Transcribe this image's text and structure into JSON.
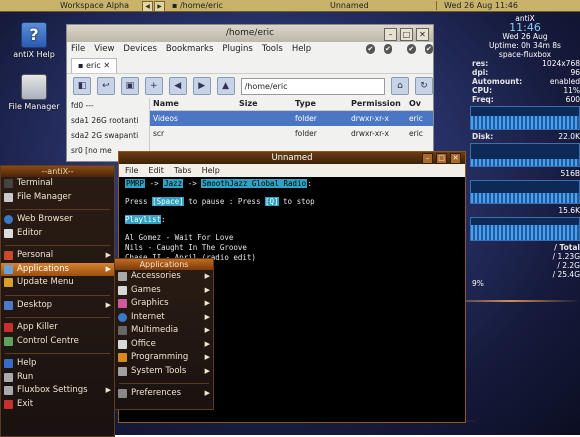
{
  "topbar": {
    "workspace": "Workspace Alpha",
    "tasks": [
      "/home/eric",
      "Unnamed"
    ],
    "datetime": "Wed 26 Aug",
    "time": "11:46"
  },
  "desktop_icons": [
    {
      "label": "antiX Help",
      "icon": "help-icon"
    },
    {
      "label": "File Manager",
      "icon": "file-manager-icon"
    }
  ],
  "conky": {
    "host": "antiX",
    "time": "11:46",
    "date": "Wed 26 Aug",
    "uptime": "Uptime: 0h 34m 8s",
    "wm": "space-fluxbox",
    "stats": [
      {
        "k": "res:",
        "v": "1024x768"
      },
      {
        "k": "dpi:",
        "v": "96"
      },
      {
        "k": "Automount:",
        "v": "enabled"
      },
      {
        "k": "CPU:",
        "v": "11%"
      },
      {
        "k": "Freq:",
        "v": "600"
      }
    ],
    "disk_label": "Disk:",
    "disk_value": "22.0K",
    "net1": "516B",
    "net2": "15.6K",
    "total_label": "/ Total",
    "totals": [
      "/ 1.23G",
      "/ 2.2G",
      "/ 25.4G"
    ],
    "percent": "9%"
  },
  "file_manager": {
    "title": "/home/eric",
    "menu": [
      "File",
      "View",
      "Devices",
      "Bookmarks",
      "Plugins",
      "Tools",
      "Help"
    ],
    "tab": "eric",
    "path": "/home/eric",
    "sidebar": [
      "fd0 ---",
      "sda1 26G rootanti",
      "sda2 2G swapanti",
      "sr0 [no me"
    ],
    "columns": [
      "Name",
      "Size",
      "Type",
      "Permission",
      "Ov"
    ],
    "rows": [
      {
        "name": "Videos",
        "size": "",
        "type": "folder",
        "perm": "drwxr-xr-x",
        "o": "eric"
      },
      {
        "name": "scr",
        "size": "",
        "type": "folder",
        "perm": "drwxr-xr-x",
        "o": "eric"
      }
    ]
  },
  "terminal": {
    "title": "Unnamed",
    "menu": [
      "File",
      "Edit",
      "Tabs",
      "Help"
    ],
    "line1": [
      "PMRP",
      "Jazz",
      "SmoothJazz Global Radio"
    ],
    "arrow": "->",
    "pause_pre": "Press",
    "pause_key": "[Space]",
    "pause_mid": "to pause : Press",
    "stop_key": "[Q]",
    "stop_post": "to stop",
    "playlist_label": "Playlist",
    "tracks": [
      "Al Gomez - Wait For Love",
      "Nils - Caught In The Groove",
      "Chase II - April (radio edit)"
    ]
  },
  "antix_menu": {
    "title": "--antiX--",
    "items": [
      {
        "label": "Terminal",
        "icon": "terminal-icon",
        "color": "#444444"
      },
      {
        "label": "File Manager",
        "icon": "folder-icon",
        "color": "#c9c9c9"
      },
      {
        "label": "Web Browser",
        "icon": "globe-icon",
        "color": "#3a78c8"
      },
      {
        "label": "Editor",
        "icon": "editor-icon",
        "color": "#dddddd"
      },
      {
        "label": "Personal",
        "icon": "personal-icon",
        "color": "#c94a2a"
      },
      {
        "label": "Applications",
        "icon": "applications-icon",
        "color": "#6aa0d8"
      },
      {
        "label": "Update Menu",
        "icon": "update-icon",
        "color": "#d8a030"
      },
      {
        "label": "Desktop",
        "icon": "desktop-icon",
        "color": "#4a7ac8"
      },
      {
        "label": "App Killer",
        "icon": "killer-icon",
        "color": "#c83030"
      },
      {
        "label": "Control Centre",
        "icon": "control-icon",
        "color": "#60a060"
      },
      {
        "label": "Help",
        "icon": "help-icon",
        "color": "#3a6ac8"
      },
      {
        "label": "Run",
        "icon": "run-icon",
        "color": "#aaaaaa"
      },
      {
        "label": "Fluxbox Settings",
        "icon": "settings-icon",
        "color": "#aaaaaa"
      },
      {
        "label": "Exit",
        "icon": "exit-icon",
        "color": "#c83030"
      }
    ]
  },
  "applications_submenu": {
    "title": "Applications",
    "items": [
      {
        "label": "Accessories",
        "color": "#aaaaaa"
      },
      {
        "label": "Games",
        "color": "#d8d8d8"
      },
      {
        "label": "Graphics",
        "color": "#d05aa0"
      },
      {
        "label": "Internet",
        "color": "#3a78c8"
      },
      {
        "label": "Multimedia",
        "color": "#666666"
      },
      {
        "label": "Office",
        "color": "#d8d8d8"
      },
      {
        "label": "Programming",
        "color": "#d88a20"
      },
      {
        "label": "System Tools",
        "color": "#a0a0a0"
      },
      {
        "label": "Preferences",
        "color": "#888888"
      }
    ]
  }
}
